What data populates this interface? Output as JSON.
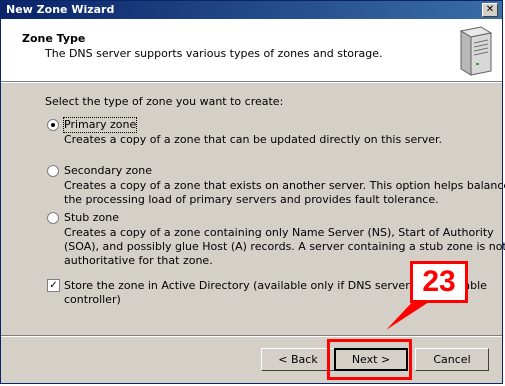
{
  "window": {
    "title": "New Zone Wizard",
    "close_glyph": "✕"
  },
  "header": {
    "title": "Zone Type",
    "subtitle": "The DNS server supports various types of zones and storage.",
    "icon": "server-icon"
  },
  "prompt": "Select the type of zone you want to create:",
  "options": [
    {
      "label": "Primary zone",
      "selected": true,
      "desc": [
        "Creates a copy of a zone that can be updated directly on this server."
      ]
    },
    {
      "label": "Secondary zone",
      "selected": false,
      "desc": [
        "Creates a copy of a zone that exists on another server. This option helps balance",
        "the processing load of primary servers and provides fault tolerance."
      ]
    },
    {
      "label": "Stub zone",
      "selected": false,
      "desc": [
        "Creates a copy of a zone containing only Name Server (NS), Start of Authority",
        "(SOA), and possibly glue Host (A) records. A server containing a stub zone is not",
        "authoritative for that zone."
      ]
    }
  ],
  "ad_checkbox": {
    "checked": true,
    "check_glyph": "✓",
    "label_lines": [
      "Store the zone in Active Directory (available only if DNS server is a writeable",
      "controller)"
    ]
  },
  "buttons": {
    "back": "< Back",
    "next": "Next >",
    "cancel": "Cancel"
  },
  "annotation": {
    "number": "23",
    "color": "#ff0000"
  }
}
